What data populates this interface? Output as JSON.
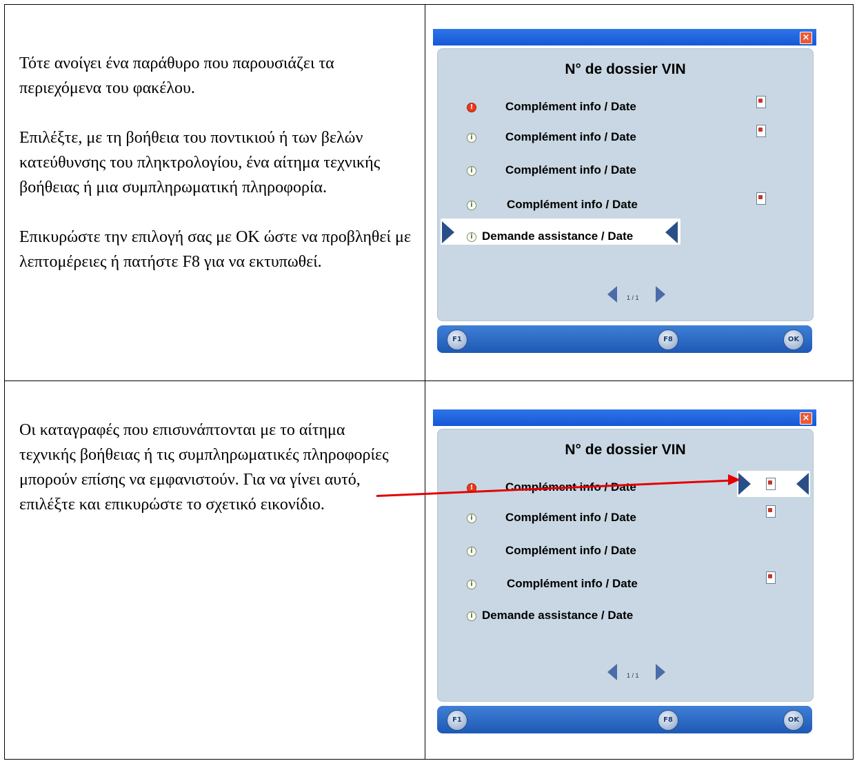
{
  "rows_text": [
    {
      "paragraphs": [
        "Τότε ανοίγει ένα παράθυρο που παρουσιάζει τα περιεχόμενα του φακέλου.",
        "Επιλέξτε, με τη βοήθεια του ποντικιού ή των βελών κατεύθυνσης του πληκτρολογίου, ένα αίτημα τεχνικής βοήθειας ή μια συμπληρωματική πληροφορία.",
        "Επικυρώστε την επιλογή σας με ΟΚ ώστε να προβληθεί με λεπτομέρειες ή πατήστε F8 για να εκτυπωθεί."
      ]
    },
    {
      "paragraphs": [
        "Οι καταγραφές που επισυνάπτονται με το αίτημα τεχνικής βοήθειας ή τις συμπληρωματικές πληροφορίες μπορούν επίσης να εμφανιστούν. Για να γίνει αυτό, επιλέξτε και επικυρώστε το σχετικό εικονίδιο."
      ]
    }
  ],
  "dialog": {
    "close": "×",
    "title": "N° de dossier   VIN",
    "items": [
      {
        "label": "Complément info  /  Date"
      },
      {
        "label": "Complément info  /  Date"
      },
      {
        "label": "Complément info  /  Date"
      },
      {
        "label": "Complément info  /  Date"
      },
      {
        "label": "Demande assistance  /  Date"
      }
    ],
    "icon_info": "i",
    "icon_warn": "!",
    "pager": "1 / 1",
    "toolbar": {
      "f1": "F1",
      "f8": "F8",
      "ok": "OK"
    }
  }
}
